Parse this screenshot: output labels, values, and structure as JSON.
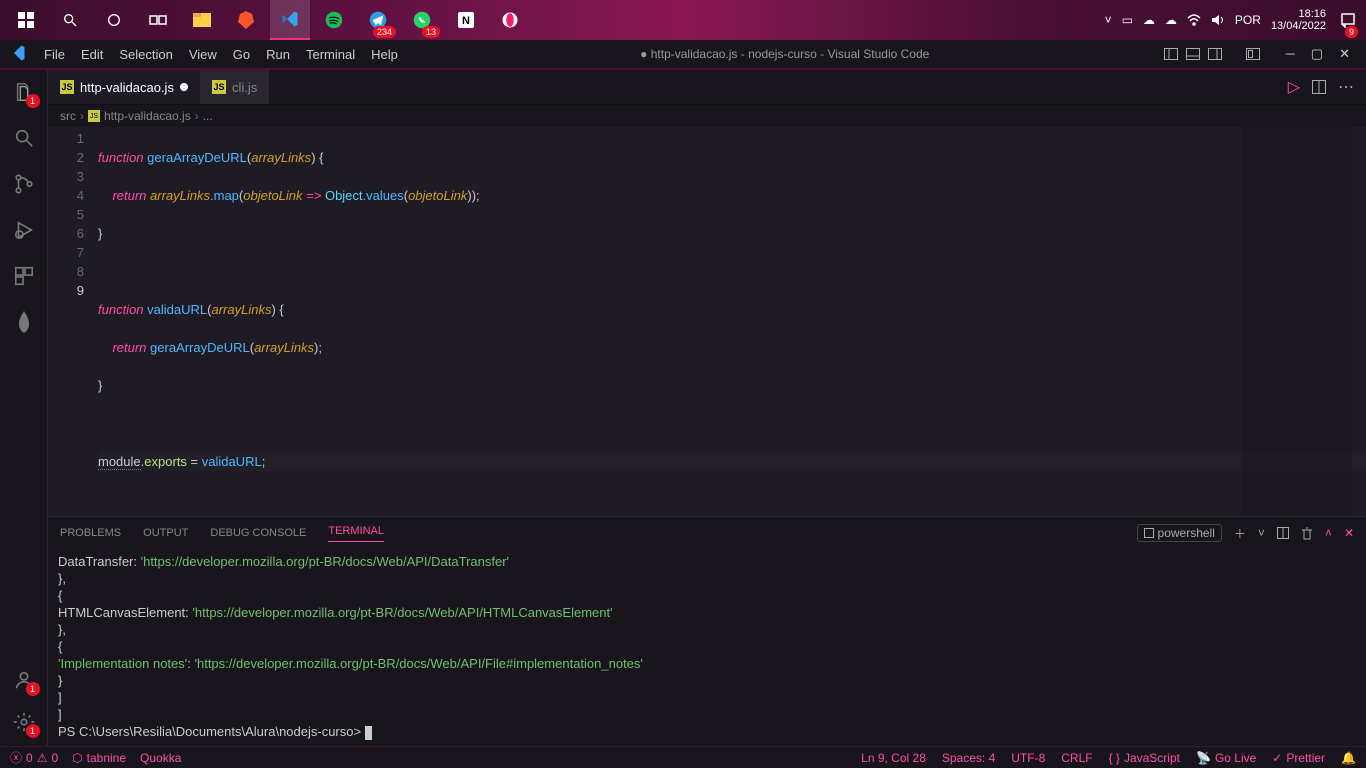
{
  "taskbar": {
    "clock_time": "18:16",
    "clock_date": "13/04/2022",
    "lang": "POR",
    "notif_badge": "9",
    "discord_badge": "234",
    "whatsapp_badge": "13"
  },
  "menubar": {
    "items": [
      "File",
      "Edit",
      "Selection",
      "View",
      "Go",
      "Run",
      "Terminal",
      "Help"
    ],
    "title": "● http-validacao.js - nodejs-curso - Visual Studio Code"
  },
  "activitybar": {
    "explorer_badge": "1",
    "accounts_badge": "1",
    "settings_badge": "1"
  },
  "tabs": {
    "active": "http-validacao.js",
    "inactive": "cli.js"
  },
  "breadcrumb": {
    "p0": "src",
    "p1": "http-validacao.js",
    "p2": "..."
  },
  "code": {
    "lines": [
      "1",
      "2",
      "3",
      "4",
      "5",
      "6",
      "7",
      "8",
      "9"
    ],
    "l1_kw": "function",
    "l1_fn": " geraArrayDeURL",
    "l1_p": "arrayLinks",
    "l1_brace": ") {",
    "l2_ret": "return ",
    "l2_arr": "arrayLinks",
    "l2_map": ".map",
    "l2_ol": "objetoLink",
    "l2_arrow": " => ",
    "l2_obj": "Object",
    "l2_vals": ".values",
    "l2_ol2": "objetoLink",
    "l2_end": "));",
    "l3": "}",
    "l5_kw": "function",
    "l5_fn": " validaURL",
    "l5_p": "arrayLinks",
    "l5_brace": ") {",
    "l6_ret": "return ",
    "l6_fn": "geraArrayDeURL",
    "l6_p": "arrayLinks",
    "l6_end": ");",
    "l7": "}",
    "l9_mod": "module",
    "l9_exp": ".exports",
    "l9_eq": " = ",
    "l9_fn": "validaURL",
    "l9_end": ";"
  },
  "panel": {
    "tabs": [
      "PROBLEMS",
      "OUTPUT",
      "DEBUG CONSOLE",
      "TERMINAL"
    ],
    "shell": "powershell",
    "out": {
      "k1": "    DataTransfer: ",
      "s1": "'https://developer.mozilla.org/pt-BR/docs/Web/API/DataTransfer'",
      "b1": "  },",
      "b2": "  {",
      "k2": "    HTMLCanvasElement: ",
      "s2": "'https://developer.mozilla.org/pt-BR/docs/Web/API/HTMLCanvasElement'",
      "b3": "  },",
      "b4": "  {",
      "k3": "    'Implementation notes'",
      "k3a": ": ",
      "s3": "'https://developer.mozilla.org/pt-BR/docs/Web/API/File#implementation_notes'",
      "b5": "  }",
      "b6": " ]",
      "b7": "]",
      "prompt": "PS C:\\Users\\Resilia\\Documents\\Alura\\nodejs-curso> "
    }
  },
  "statusbar": {
    "errors": "0",
    "warnings": "0",
    "tabnine": "tabnine",
    "quokka": "Quokka",
    "lncol": "Ln 9, Col 28",
    "spaces": "Spaces: 4",
    "enc": "UTF-8",
    "eol": "CRLF",
    "lang": "JavaScript",
    "golive": "Go Live",
    "prettier": "Prettier"
  }
}
